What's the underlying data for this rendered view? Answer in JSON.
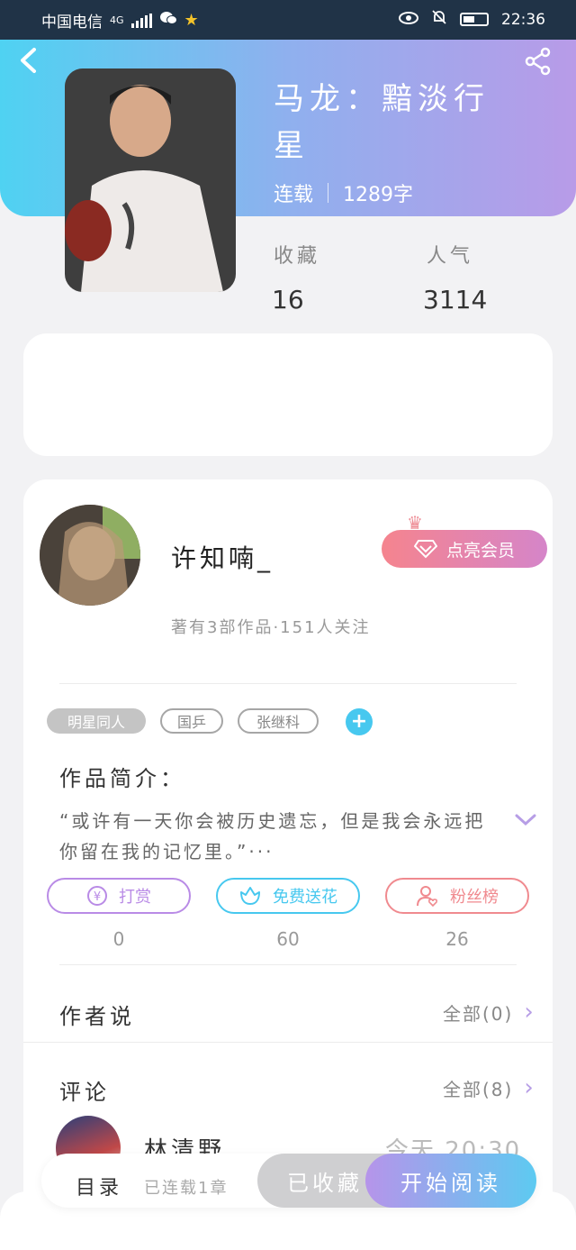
{
  "status_bar": {
    "carrier": "中国电信",
    "network": "4G",
    "time": "22:36"
  },
  "book": {
    "title": "马龙：黯淡行星",
    "status": "连载",
    "word_count": "1289字",
    "collect_label": "收藏",
    "collect_count": "16",
    "popularity_label": "人气",
    "popularity_count": "3114"
  },
  "author": {
    "name": "许知喃_",
    "vip_button": "点亮会员",
    "meta": "著有3部作品·151人关注"
  },
  "tags": [
    "明星同人",
    "国乒",
    "张继科"
  ],
  "intro": {
    "title": "作品简介：",
    "text": "“或许有一天你会被历史遗忘，但是我会永远把你留在我的记忆里。”···"
  },
  "actions": [
    {
      "label": "打赏",
      "count": "0",
      "color": "#b98be6"
    },
    {
      "label": "免费送花",
      "count": "60",
      "color": "#47c8ef"
    },
    {
      "label": "粉丝榜",
      "count": "26",
      "color": "#f08a8f"
    }
  ],
  "author_says": {
    "title": "作者说",
    "right": "全部(0)"
  },
  "comments": {
    "title": "评论",
    "right": "全部(8)",
    "first_user": "林清野",
    "first_time": "今天 20:30"
  },
  "bottom_bar": {
    "catalog": "目录",
    "updated": "已连载1章",
    "collected": "已收藏",
    "read": "开始阅读"
  }
}
